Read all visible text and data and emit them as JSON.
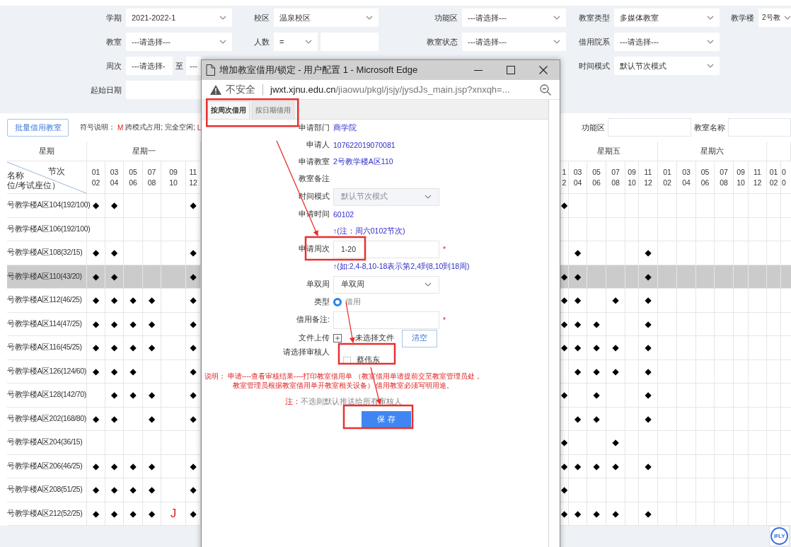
{
  "filters": {
    "rows": [
      [
        {
          "label": "学期",
          "kind": "select",
          "value": "2021-2022-1"
        },
        {
          "label": "校区",
          "kind": "select",
          "value": "温泉校区"
        },
        {
          "label": "功能区",
          "kind": "select",
          "value": "---请选择---"
        },
        {
          "label": "教室类型",
          "kind": "select",
          "value": "多媒体教室"
        },
        {
          "label": "教学楼",
          "kind": "select",
          "value": "2号教"
        }
      ],
      [
        {
          "label": "教室",
          "kind": "select",
          "value": "---请选择---"
        },
        {
          "label": "人数",
          "kind": "compare",
          "operator": "="
        },
        {
          "label": "教室状态",
          "kind": "select",
          "value": "---请选择---"
        },
        {
          "label": "借用院系",
          "kind": "select",
          "value": "---请选择---"
        }
      ],
      [
        {
          "label": "周次",
          "kind": "range",
          "from": "---请选择-",
          "separator": "至",
          "to": "---"
        },
        null,
        null,
        {
          "label": "时间模式",
          "kind": "select",
          "value": "默认节次模式"
        }
      ],
      [
        {
          "label": "起始日期",
          "kind": "input"
        }
      ]
    ]
  },
  "toolbar": {
    "button": "批量借用教室",
    "legend_label": "符号说明：",
    "legend": [
      {
        "symbol": "M",
        "text": "跨模式占用; 完全空闲;"
      },
      {
        "symbol": "L"
      }
    ],
    "search": [
      {
        "label": "功能区"
      },
      {
        "label": "教室名称"
      }
    ]
  },
  "table": {
    "corner": {
      "week": "星期",
      "slot": "节次",
      "room_1": "名称",
      "room_2": "位/考试座位）"
    },
    "left_day": "星期一",
    "left_slots": [
      [
        "01",
        "02"
      ],
      [
        "03",
        "04"
      ],
      [
        "05",
        "06"
      ],
      [
        "07",
        "08"
      ],
      [
        "09",
        "10"
      ],
      [
        "11",
        "12"
      ]
    ],
    "right_days": [
      {
        "name": "星期五",
        "slots": [
          [
            "1",
            "2"
          ],
          [
            "03",
            "04"
          ],
          [
            "05",
            "06"
          ],
          [
            "07",
            "08"
          ],
          [
            "09",
            "10"
          ],
          [
            "11",
            "12"
          ]
        ]
      },
      {
        "name": "星期六",
        "slots": [
          [
            "01",
            "02"
          ],
          [
            "03",
            "04"
          ],
          [
            "05",
            "06"
          ],
          [
            "07",
            "08"
          ],
          [
            "09",
            "10"
          ],
          [
            "11",
            "12"
          ]
        ]
      },
      {
        "slots": [
          [
            "01",
            "02"
          ],
          [
            "0",
            "0"
          ]
        ]
      }
    ],
    "rows": [
      {
        "room": "号教学楼A区104(192/100)",
        "selected": false,
        "left": [
          {
            "kind": "busy",
            "text": "◆"
          },
          {
            "kind": "busy",
            "text": "◆"
          },
          {
            "kind": "free"
          },
          {
            "kind": "free"
          },
          {
            "kind": "free"
          },
          {
            "kind": "busy",
            "text": "◆"
          }
        ],
        "right": [
          {
            "kind": "busy",
            "text": "◆"
          },
          {
            "kind": "free"
          },
          {
            "kind": "free"
          },
          {
            "kind": "free"
          },
          {
            "kind": "free"
          },
          {
            "kind": "free"
          },
          {
            "kind": "free"
          },
          {
            "kind": "free"
          },
          {
            "kind": "free"
          },
          {
            "kind": "free"
          },
          {
            "kind": "free"
          },
          {
            "kind": "free"
          },
          {
            "kind": "free"
          }
        ]
      },
      {
        "room": "号教学楼A区106(192/100)",
        "selected": false,
        "left": [
          {
            "kind": "free"
          },
          {
            "kind": "free"
          },
          {
            "kind": "free"
          },
          {
            "kind": "free"
          },
          {
            "kind": "free"
          },
          {
            "kind": "free"
          }
        ],
        "right": [
          {
            "kind": "free"
          },
          {
            "kind": "free"
          },
          {
            "kind": "free"
          },
          {
            "kind": "free"
          },
          {
            "kind": "free"
          },
          {
            "kind": "free"
          },
          {
            "kind": "free"
          },
          {
            "kind": "free"
          },
          {
            "kind": "free"
          },
          {
            "kind": "free"
          },
          {
            "kind": "free"
          },
          {
            "kind": "free"
          },
          {
            "kind": "free"
          }
        ]
      },
      {
        "room": "号教学楼A区108(32/15)",
        "selected": false,
        "left": [
          {
            "kind": "busy",
            "text": "◆"
          },
          {
            "kind": "busy",
            "text": "◆"
          },
          {
            "kind": "free"
          },
          {
            "kind": "free"
          },
          {
            "kind": "free"
          },
          {
            "kind": "busy",
            "text": "◆"
          }
        ],
        "right": [
          {
            "kind": "free"
          },
          {
            "kind": "busy",
            "text": "◆"
          },
          {
            "kind": "free"
          },
          {
            "kind": "free"
          },
          {
            "kind": "free"
          },
          {
            "kind": "busy",
            "text": "◆"
          },
          {
            "kind": "free"
          },
          {
            "kind": "free"
          },
          {
            "kind": "free"
          },
          {
            "kind": "free"
          },
          {
            "kind": "free"
          },
          {
            "kind": "free"
          },
          {
            "kind": "free"
          }
        ]
      },
      {
        "room": "号教学楼A区110(43/20)",
        "selected": true,
        "left": [
          {
            "kind": "busy",
            "text": "◆"
          },
          {
            "kind": "busy",
            "text": "◆"
          },
          {
            "kind": "free"
          },
          {
            "kind": "free"
          },
          {
            "kind": "free"
          },
          {
            "kind": "busy",
            "text": "◆"
          }
        ],
        "right": [
          {
            "kind": "busy",
            "text": "◆"
          },
          {
            "kind": "busy",
            "text": "◆"
          },
          {
            "kind": "free"
          },
          {
            "kind": "free"
          },
          {
            "kind": "free"
          },
          {
            "kind": "busy",
            "text": "◆"
          },
          {
            "kind": "free"
          },
          {
            "kind": "free"
          },
          {
            "kind": "free"
          },
          {
            "kind": "free"
          },
          {
            "kind": "free"
          },
          {
            "kind": "free"
          },
          {
            "kind": "free"
          }
        ]
      },
      {
        "room": "号教学楼A区112(46/25)",
        "selected": false,
        "left": [
          {
            "kind": "busy",
            "text": "◆"
          },
          {
            "kind": "busy",
            "text": "◆"
          },
          {
            "kind": "busy",
            "text": "◆"
          },
          {
            "kind": "busy",
            "text": "◆"
          },
          {
            "kind": "free"
          },
          {
            "kind": "busy",
            "text": "◆"
          }
        ],
        "right": [
          {
            "kind": "busy",
            "text": "◆"
          },
          {
            "kind": "busy",
            "text": "◆"
          },
          {
            "kind": "free"
          },
          {
            "kind": "busy",
            "text": "◆"
          },
          {
            "kind": "free"
          },
          {
            "kind": "busy",
            "text": "◆"
          },
          {
            "kind": "free"
          },
          {
            "kind": "free"
          },
          {
            "kind": "free"
          },
          {
            "kind": "free"
          },
          {
            "kind": "free"
          },
          {
            "kind": "free"
          },
          {
            "kind": "free"
          }
        ]
      },
      {
        "room": "号教学楼A区114(47/25)",
        "selected": false,
        "left": [
          {
            "kind": "busy",
            "text": "◆"
          },
          {
            "kind": "busy",
            "text": "◆"
          },
          {
            "kind": "busy",
            "text": "◆"
          },
          {
            "kind": "busy",
            "text": "◆"
          },
          {
            "kind": "free"
          },
          {
            "kind": "busy",
            "text": "◆"
          }
        ],
        "right": [
          {
            "kind": "busy",
            "text": "◆"
          },
          {
            "kind": "busy",
            "text": "◆"
          },
          {
            "kind": "busy",
            "text": "◆"
          },
          {
            "kind": "free"
          },
          {
            "kind": "free"
          },
          {
            "kind": "busy",
            "text": "◆"
          },
          {
            "kind": "free"
          },
          {
            "kind": "free"
          },
          {
            "kind": "free"
          },
          {
            "kind": "free"
          },
          {
            "kind": "free"
          },
          {
            "kind": "free"
          },
          {
            "kind": "free"
          }
        ]
      },
      {
        "room": "号教学楼A区116(45/25)",
        "selected": false,
        "left": [
          {
            "kind": "busy",
            "text": "◆"
          },
          {
            "kind": "busy",
            "text": "◆"
          },
          {
            "kind": "busy",
            "text": "◆"
          },
          {
            "kind": "busy",
            "text": "◆"
          },
          {
            "kind": "free"
          },
          {
            "kind": "busy",
            "text": "◆"
          }
        ],
        "right": [
          {
            "kind": "busy",
            "text": "◆"
          },
          {
            "kind": "busy",
            "text": "◆"
          },
          {
            "kind": "busy",
            "text": "◆"
          },
          {
            "kind": "busy",
            "text": "◆"
          },
          {
            "kind": "free"
          },
          {
            "kind": "busy",
            "text": "◆"
          },
          {
            "kind": "free"
          },
          {
            "kind": "free"
          },
          {
            "kind": "free"
          },
          {
            "kind": "free"
          },
          {
            "kind": "free"
          },
          {
            "kind": "free"
          },
          {
            "kind": "free"
          }
        ]
      },
      {
        "room": "号教学楼A区126(124/60)",
        "selected": false,
        "left": [
          {
            "kind": "busy",
            "text": "◆"
          },
          {
            "kind": "busy",
            "text": "◆"
          },
          {
            "kind": "busy",
            "text": "◆"
          },
          {
            "kind": "free"
          },
          {
            "kind": "free"
          },
          {
            "kind": "busy",
            "text": "◆"
          }
        ],
        "right": [
          {
            "kind": "free"
          },
          {
            "kind": "busy",
            "text": "◆"
          },
          {
            "kind": "busy",
            "text": "◆"
          },
          {
            "kind": "busy",
            "text": "◆"
          },
          {
            "kind": "free"
          },
          {
            "kind": "busy",
            "text": "◆"
          },
          {
            "kind": "free"
          },
          {
            "kind": "free"
          },
          {
            "kind": "free"
          },
          {
            "kind": "free"
          },
          {
            "kind": "free"
          },
          {
            "kind": "free"
          },
          {
            "kind": "free"
          }
        ]
      },
      {
        "room": "号教学楼A区128(142/70)",
        "selected": false,
        "left": [
          {
            "kind": "free"
          },
          {
            "kind": "busy",
            "text": "◆"
          },
          {
            "kind": "busy",
            "text": "◆"
          },
          {
            "kind": "busy",
            "text": "◆"
          },
          {
            "kind": "free"
          },
          {
            "kind": "busy",
            "text": "◆"
          }
        ],
        "right": [
          {
            "kind": "busy",
            "text": "◆"
          },
          {
            "kind": "free"
          },
          {
            "kind": "busy",
            "text": "◆"
          },
          {
            "kind": "free"
          },
          {
            "kind": "free"
          },
          {
            "kind": "busy",
            "text": "◆"
          },
          {
            "kind": "free"
          },
          {
            "kind": "free"
          },
          {
            "kind": "free"
          },
          {
            "kind": "free"
          },
          {
            "kind": "free"
          },
          {
            "kind": "free"
          },
          {
            "kind": "free"
          }
        ]
      },
      {
        "room": "号教学楼A区202(168/80)",
        "selected": false,
        "left": [
          {
            "kind": "busy",
            "text": "◆"
          },
          {
            "kind": "busy",
            "text": "◆"
          },
          {
            "kind": "free"
          },
          {
            "kind": "busy",
            "text": "◆"
          },
          {
            "kind": "free"
          },
          {
            "kind": "busy",
            "text": "◆"
          }
        ],
        "right": [
          {
            "kind": "free"
          },
          {
            "kind": "busy",
            "text": "◆"
          },
          {
            "kind": "busy",
            "text": "◆"
          },
          {
            "kind": "free"
          },
          {
            "kind": "free"
          },
          {
            "kind": "busy",
            "text": "◆"
          },
          {
            "kind": "free"
          },
          {
            "kind": "free"
          },
          {
            "kind": "free"
          },
          {
            "kind": "free"
          },
          {
            "kind": "free"
          },
          {
            "kind": "free"
          },
          {
            "kind": "free"
          }
        ]
      },
      {
        "room": "号教学楼A区204(36/15)",
        "selected": false,
        "left": [
          {
            "kind": "free"
          },
          {
            "kind": "free"
          },
          {
            "kind": "free"
          },
          {
            "kind": "free"
          },
          {
            "kind": "free"
          },
          {
            "kind": "free"
          }
        ],
        "right": [
          {
            "kind": "busy",
            "text": "◆"
          },
          {
            "kind": "free"
          },
          {
            "kind": "free"
          },
          {
            "kind": "busy",
            "text": "◆"
          },
          {
            "kind": "free"
          },
          {
            "kind": "free"
          },
          {
            "kind": "free"
          },
          {
            "kind": "free"
          },
          {
            "kind": "free"
          },
          {
            "kind": "free"
          },
          {
            "kind": "free"
          },
          {
            "kind": "free"
          },
          {
            "kind": "free"
          }
        ]
      },
      {
        "room": "号教学楼A区206(46/25)",
        "selected": false,
        "left": [
          {
            "kind": "busy",
            "text": "◆"
          },
          {
            "kind": "busy",
            "text": "◆"
          },
          {
            "kind": "busy",
            "text": "◆"
          },
          {
            "kind": "busy",
            "text": "◆"
          },
          {
            "kind": "free"
          },
          {
            "kind": "busy",
            "text": "◆"
          }
        ],
        "right": [
          {
            "kind": "busy",
            "text": "◆"
          },
          {
            "kind": "busy",
            "text": "◆"
          },
          {
            "kind": "busy",
            "text": "◆"
          },
          {
            "kind": "busy",
            "text": "◆"
          },
          {
            "kind": "free"
          },
          {
            "kind": "busy",
            "text": "◆"
          },
          {
            "kind": "free"
          },
          {
            "kind": "free"
          },
          {
            "kind": "free"
          },
          {
            "kind": "free"
          },
          {
            "kind": "free"
          },
          {
            "kind": "free"
          },
          {
            "kind": "free"
          }
        ]
      },
      {
        "room": "号教学楼A区208(51/25)",
        "selected": false,
        "left": [
          {
            "kind": "busy",
            "text": "◆"
          },
          {
            "kind": "busy",
            "text": "◆"
          },
          {
            "kind": "busy",
            "text": "◆"
          },
          {
            "kind": "busy",
            "text": "◆"
          },
          {
            "kind": "free"
          },
          {
            "kind": "busy",
            "text": "◆"
          }
        ],
        "right": [
          {
            "kind": "busy",
            "text": "◆"
          },
          {
            "kind": "free"
          },
          {
            "kind": "free"
          },
          {
            "kind": "free"
          },
          {
            "kind": "free"
          },
          {
            "kind": "free"
          },
          {
            "kind": "free"
          },
          {
            "kind": "free"
          },
          {
            "kind": "free"
          },
          {
            "kind": "free"
          },
          {
            "kind": "free"
          },
          {
            "kind": "free"
          },
          {
            "kind": "free"
          }
        ]
      },
      {
        "room": "号教学楼A区212(52/25)",
        "selected": false,
        "left": [
          {
            "kind": "busy",
            "text": "◆"
          },
          {
            "kind": "busy",
            "text": "◆"
          },
          {
            "kind": "busy",
            "text": "◆"
          },
          {
            "kind": "busy",
            "text": "◆"
          },
          {
            "kind": "lock",
            "text": "J",
            "color": "#e02020"
          },
          {
            "kind": "busy",
            "text": "◆"
          }
        ],
        "right": [
          {
            "kind": "busy",
            "text": "◆"
          },
          {
            "kind": "busy",
            "text": "◆"
          },
          {
            "kind": "busy",
            "text": "◆"
          },
          {
            "kind": "busy",
            "text": "◆"
          },
          {
            "kind": "free"
          },
          {
            "kind": "busy",
            "text": "◆"
          },
          {
            "kind": "free"
          },
          {
            "kind": "free"
          },
          {
            "kind": "free"
          },
          {
            "kind": "free"
          },
          {
            "kind": "free"
          },
          {
            "kind": "free"
          },
          {
            "kind": "free"
          }
        ]
      }
    ]
  },
  "popup": {
    "title": "增加教室借用/锁定 - 用户配置 1 - Microsoft Edge",
    "security": "不安全",
    "url": {
      "host": "jwxt.xjnu.edu.cn",
      "path": "/jiaowu/pkgl/jsjy/jysdJs_main.jsp?xnxqh=..."
    },
    "tabs": [
      {
        "label": "按周次借用",
        "selected": true
      },
      {
        "label": "按日期借用",
        "selected": false
      }
    ],
    "form": [
      {
        "kind": "text",
        "label": "申请部门",
        "value": "商学院"
      },
      {
        "kind": "text",
        "label": "申请人",
        "value": "107622019070081"
      },
      {
        "kind": "text",
        "label": "申请教室",
        "value": "2号教学楼A区110"
      },
      {
        "kind": "text",
        "label": "教室备注"
      },
      {
        "kind": "select",
        "label": "时间模式",
        "value": "默认节次模式",
        "disabled": true
      },
      {
        "kind": "text",
        "label": "申请时间",
        "value": "60102"
      },
      {
        "kind": "hint",
        "value": "↑(注：周六0102节次)"
      },
      {
        "kind": "input",
        "label": "申请周次",
        "value": "1-20",
        "required_mark": "*"
      },
      {
        "kind": "hint",
        "value": "↑(如:2,4-8,10-18表示第2,4到8,10到18周)"
      },
      {
        "kind": "select",
        "label": "单双周",
        "value": "单双周",
        "disabled": false
      },
      {
        "kind": "radio",
        "label": "类型",
        "option": "借用",
        "selected": true
      },
      {
        "kind": "input",
        "label": "借用备注:",
        "required_mark": "*"
      },
      {
        "kind": "file",
        "label": "文件上传",
        "status": "未选择文件",
        "button": "清空"
      },
      {
        "kind": "checkbox",
        "label": "请选择审核人",
        "option": "蔡伟东",
        "checked": false
      }
    ],
    "notice": [
      "说明： 申请----查看审核结果----打印教室借用单 （教室借用单请提前交至教室管理员处，",
      "教室管理员根据教室借用单开教室相关设备） 借用教室必须写明用途。"
    ],
    "note_label": "注：",
    "note": "不选则默认推送给所有审核人",
    "save": "保 存"
  },
  "badge": "iFLY"
}
